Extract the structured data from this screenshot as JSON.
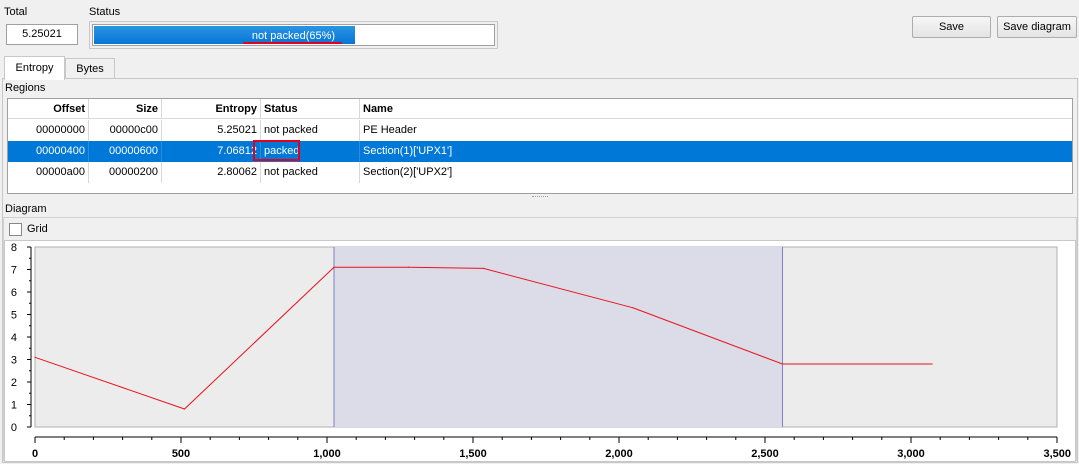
{
  "header": {
    "total_label": "Total",
    "total_value": "5.25021",
    "status_label": "Status",
    "status_text": "not packed(65%)",
    "status_progress": 0.65,
    "save_label": "Save",
    "save_diagram_label": "Save diagram"
  },
  "tabs": [
    {
      "label": "Entropy",
      "active": true
    },
    {
      "label": "Bytes",
      "active": false
    }
  ],
  "regions": {
    "title": "Regions",
    "columns": [
      "Offset",
      "Size",
      "Entropy",
      "Status",
      "Name"
    ],
    "rows": [
      {
        "offset": "00000000",
        "size": "00000c00",
        "entropy": "5.25021",
        "status": "not packed",
        "name": "PE Header",
        "selected": false
      },
      {
        "offset": "00000400",
        "size": "00000600",
        "entropy": "7.06812",
        "status": "packed",
        "name": "Section(1)['UPX1']",
        "selected": true
      },
      {
        "offset": "00000a00",
        "size": "00000200",
        "entropy": "2.80062",
        "status": "not packed",
        "name": "Section(2)['UPX2']",
        "selected": false
      }
    ]
  },
  "diagram": {
    "title": "Diagram",
    "grid_label": "Grid",
    "grid_checked": false
  },
  "colors": {
    "line": "#e8141b",
    "highlight": "#dcdce8",
    "highlight_border": "#8080c8",
    "selection": "#0078d7",
    "annotation": "#e00020"
  },
  "chart_data": {
    "type": "line",
    "x": [
      0,
      512,
      1024,
      1280,
      1536,
      2048,
      2560,
      3072
    ],
    "y": [
      3.1,
      0.8,
      7.1,
      7.1,
      7.05,
      5.3,
      2.8,
      2.8
    ],
    "xlim": [
      0,
      3500
    ],
    "ylim": [
      0,
      8
    ],
    "x_ticks": [
      0,
      500,
      1000,
      1500,
      2000,
      2500,
      3000,
      3500
    ],
    "x_tick_labels": [
      "0",
      "500",
      "1,000",
      "1,500",
      "2,000",
      "2,500",
      "3,000",
      "3,500"
    ],
    "y_ticks": [
      0,
      1,
      2,
      3,
      4,
      5,
      6,
      7,
      8
    ],
    "y_tick_labels": [
      "0",
      "1",
      "2",
      "3",
      "4",
      "5",
      "6",
      "7",
      "8"
    ],
    "highlight_range": [
      1024,
      2560
    ],
    "grid": false
  }
}
